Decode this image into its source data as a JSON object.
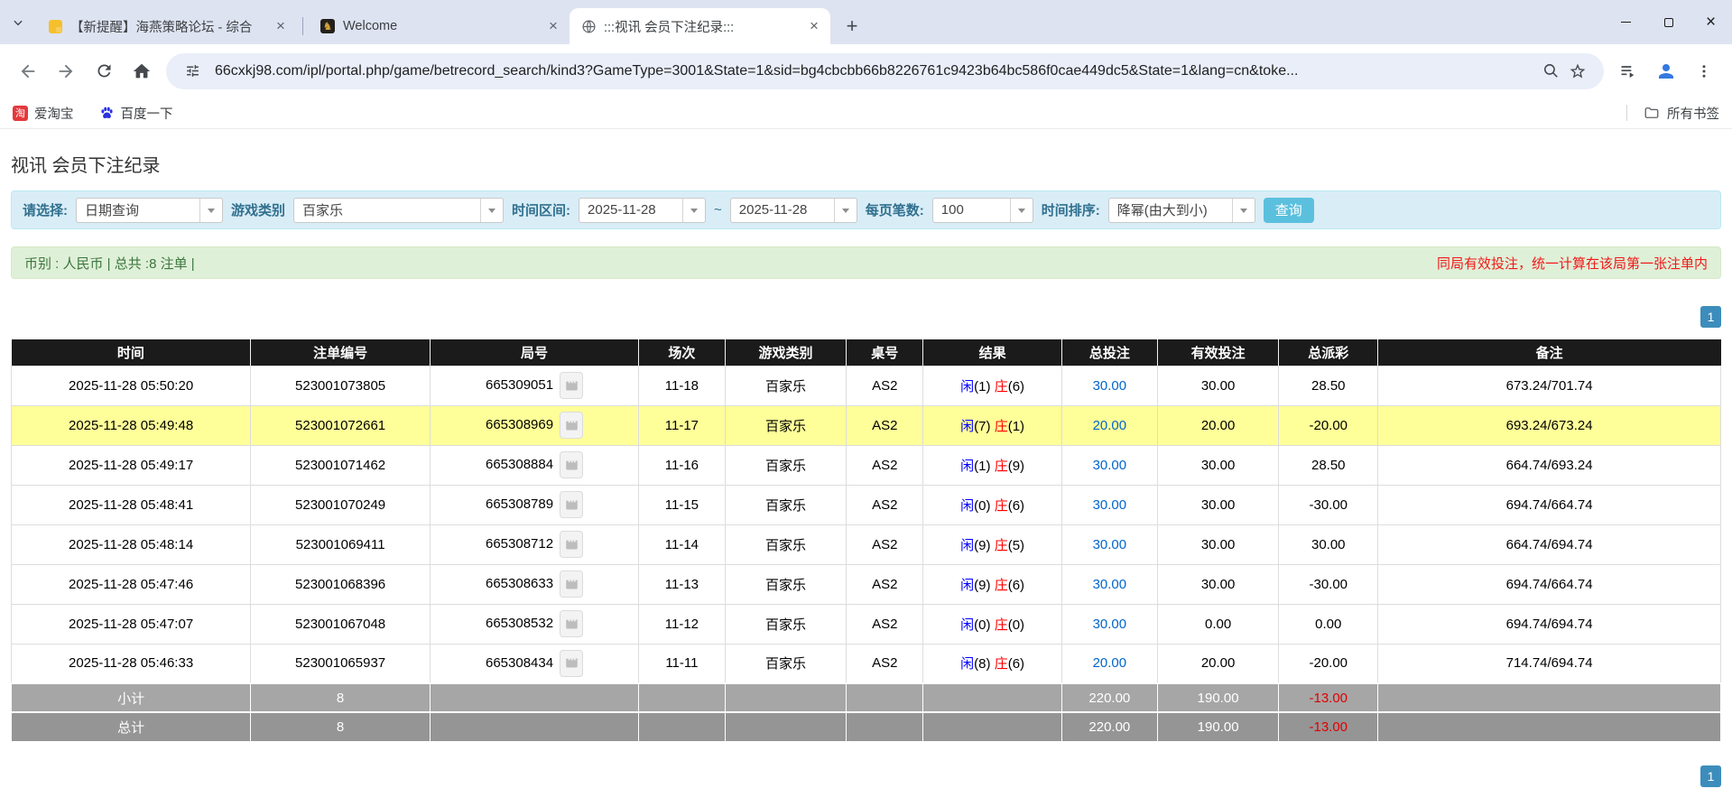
{
  "colors": {
    "accent_button": "#5bc0de",
    "pager_blue": "#3c8dbc",
    "highlight_row": "#ffff99",
    "link_blue": "#0066cc",
    "player_blue": "#0000ff",
    "banker_red": "#ff0000",
    "negative_red": "#ff0000",
    "table_header_bg": "#1b1b1b",
    "filter_bg": "#d9edf7",
    "notice_bg": "#dff0d8"
  },
  "icons": {
    "tab_search": "chevron-down",
    "nav": [
      "back-arrow",
      "forward-arrow",
      "reload",
      "home"
    ],
    "omnibox": [
      "site-info-tune",
      "zoom-magnifier",
      "bookmark-star"
    ],
    "toolbar_right": [
      "media-controls",
      "profile-person",
      "kebab-menu"
    ],
    "window": [
      "minimize",
      "maximize",
      "close"
    ],
    "bookmark_favicons": [
      "taobao-red-square",
      "baidu-paw"
    ],
    "round_cell": "video-replay"
  },
  "browser": {
    "tabs": [
      {
        "title": "【新提醒】海燕策略论坛 - 综合",
        "active": false
      },
      {
        "title": "Welcome",
        "active": false
      },
      {
        "title": ":::视讯 会员下注纪录:::",
        "active": true
      }
    ],
    "new_tab_button": "+",
    "url": "66cxkj98.com/ipl/portal.php/game/betrecord_search/kind3?GameType=3001&State=1&sid=bg4cbcbb66b8226761c9423b64bc586f0cae449dc5&State=1&lang=cn&toke...",
    "bookmarks": {
      "items": [
        {
          "label": "爱淘宝"
        },
        {
          "label": "百度一下"
        }
      ],
      "all_bookmarks_label": "所有书签"
    }
  },
  "page": {
    "title": "视讯 会员下注纪录",
    "filter": {
      "select_label": "请选择:",
      "select_value": "日期查询",
      "game_label": "游戏类别",
      "game_value": "百家乐",
      "range_label": "时间区间:",
      "date_from": "2025-11-28",
      "tilde": "~",
      "date_to": "2025-11-28",
      "pagesize_label": "每页笔数:",
      "pagesize_value": "100",
      "sort_label": "时间排序:",
      "sort_value": "降幂(由大到小)",
      "search_button": "查询"
    },
    "notice_bar": {
      "left": "币别 : 人民币 | 总共 :8 注单 |",
      "right": "同局有效投注，统一计算在该局第一张注单内"
    },
    "pagination": {
      "page": "1"
    },
    "table": {
      "headers": [
        "时间",
        "注单编号",
        "局号",
        "场次",
        "游戏类别",
        "桌号",
        "结果",
        "总投注",
        "有效投注",
        "总派彩",
        "备注"
      ],
      "rows": [
        {
          "time": "2025-11-28 05:50:20",
          "bet_no": "523001073805",
          "round_no": "665309051",
          "session": "11-18",
          "game": "百家乐",
          "table_no": "AS2",
          "player": "闲",
          "player_pts": "(1)",
          "banker": "庄",
          "banker_pts": "(6)",
          "total_bet": "30.00",
          "valid_bet": "30.00",
          "payout": "28.50",
          "note": "673.24/701.74",
          "highlight": false
        },
        {
          "time": "2025-11-28 05:49:48",
          "bet_no": "523001072661",
          "round_no": "665308969",
          "session": "11-17",
          "game": "百家乐",
          "table_no": "AS2",
          "player": "闲",
          "player_pts": "(7)",
          "banker": "庄",
          "banker_pts": "(1)",
          "total_bet": "20.00",
          "valid_bet": "20.00",
          "payout": "-20.00",
          "note": "693.24/673.24",
          "highlight": true
        },
        {
          "time": "2025-11-28 05:49:17",
          "bet_no": "523001071462",
          "round_no": "665308884",
          "session": "11-16",
          "game": "百家乐",
          "table_no": "AS2",
          "player": "闲",
          "player_pts": "(1)",
          "banker": "庄",
          "banker_pts": "(9)",
          "total_bet": "30.00",
          "valid_bet": "30.00",
          "payout": "28.50",
          "note": "664.74/693.24",
          "highlight": false
        },
        {
          "time": "2025-11-28 05:48:41",
          "bet_no": "523001070249",
          "round_no": "665308789",
          "session": "11-15",
          "game": "百家乐",
          "table_no": "AS2",
          "player": "闲",
          "player_pts": "(0)",
          "banker": "庄",
          "banker_pts": "(6)",
          "total_bet": "30.00",
          "valid_bet": "30.00",
          "payout": "-30.00",
          "note": "694.74/664.74",
          "highlight": false
        },
        {
          "time": "2025-11-28 05:48:14",
          "bet_no": "523001069411",
          "round_no": "665308712",
          "session": "11-14",
          "game": "百家乐",
          "table_no": "AS2",
          "player": "闲",
          "player_pts": "(9)",
          "banker": "庄",
          "banker_pts": "(5)",
          "total_bet": "30.00",
          "valid_bet": "30.00",
          "payout": "30.00",
          "note": "664.74/694.74",
          "highlight": false
        },
        {
          "time": "2025-11-28 05:47:46",
          "bet_no": "523001068396",
          "round_no": "665308633",
          "session": "11-13",
          "game": "百家乐",
          "table_no": "AS2",
          "player": "闲",
          "player_pts": "(9)",
          "banker": "庄",
          "banker_pts": "(6)",
          "total_bet": "30.00",
          "valid_bet": "30.00",
          "payout": "-30.00",
          "note": "694.74/664.74",
          "highlight": false
        },
        {
          "time": "2025-11-28 05:47:07",
          "bet_no": "523001067048",
          "round_no": "665308532",
          "session": "11-12",
          "game": "百家乐",
          "table_no": "AS2",
          "player": "闲",
          "player_pts": "(0)",
          "banker": "庄",
          "banker_pts": "(0)",
          "total_bet": "30.00",
          "valid_bet": "0.00",
          "payout": "0.00",
          "note": "694.74/694.74",
          "highlight": false
        },
        {
          "time": "2025-11-28 05:46:33",
          "bet_no": "523001065937",
          "round_no": "665308434",
          "session": "11-11",
          "game": "百家乐",
          "table_no": "AS2",
          "player": "闲",
          "player_pts": "(8)",
          "banker": "庄",
          "banker_pts": "(6)",
          "total_bet": "20.00",
          "valid_bet": "20.00",
          "payout": "-20.00",
          "note": "714.74/694.74",
          "highlight": false
        }
      ],
      "subtotal": {
        "label": "小计",
        "count": "8",
        "total_bet": "220.00",
        "valid_bet": "190.00",
        "payout": "-13.00"
      },
      "total": {
        "label": "总计",
        "count": "8",
        "total_bet": "220.00",
        "valid_bet": "190.00",
        "payout": "-13.00"
      }
    }
  }
}
